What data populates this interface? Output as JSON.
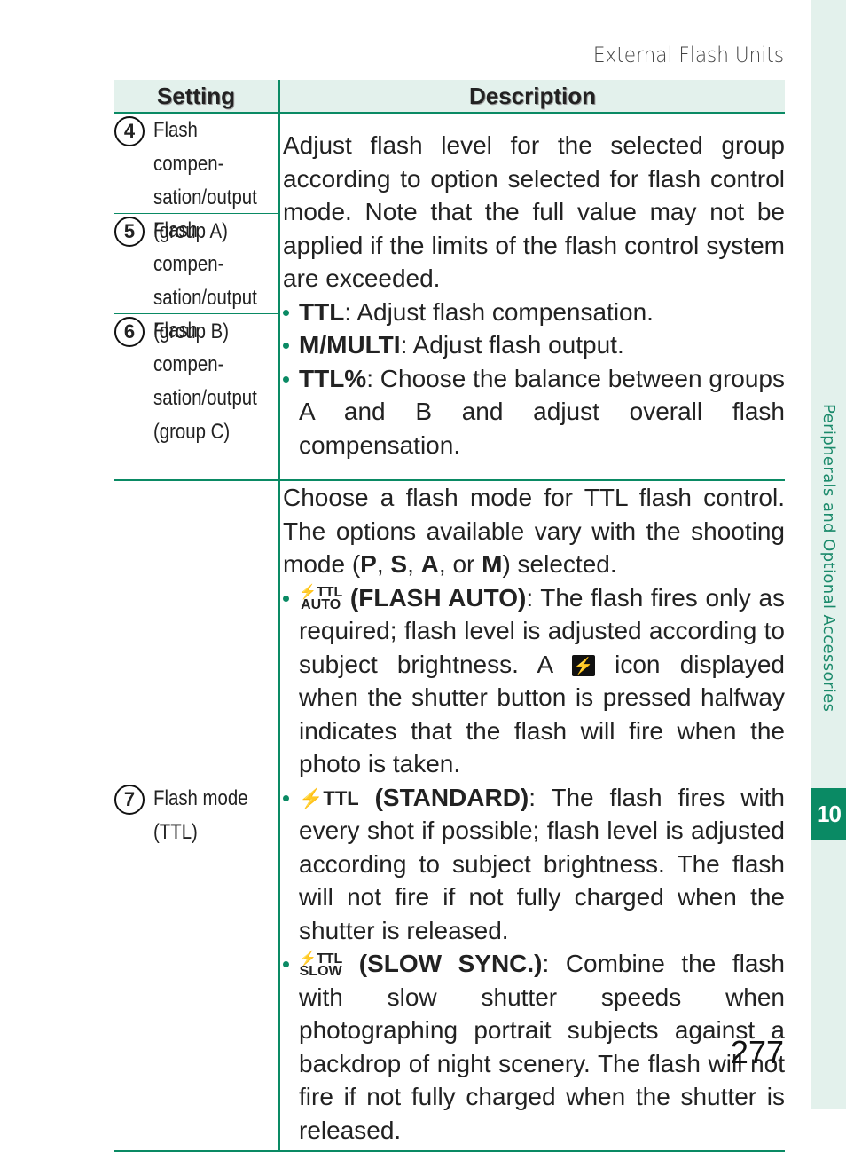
{
  "running_head": "External Flash Units",
  "page_number": "277",
  "side_tab": {
    "label": "Peripherals and Optional Accessories",
    "chapter": "10"
  },
  "table": {
    "headers": {
      "setting": "Setting",
      "description": "Description"
    },
    "group1": {
      "settings": [
        {
          "num": "4",
          "label": "Flash compen-\nsation/output\n(group A)"
        },
        {
          "num": "5",
          "label": "Flash compen-\nsation/output\n(group B)"
        },
        {
          "num": "6",
          "label": "Flash compen-\nsation/output\n(group C)"
        }
      ],
      "intro": "Adjust flash level for the selected group according to option selected for flash control mode. Note that the full value may not be applied if the limits of the flash control system are exceeded.",
      "bullets": [
        {
          "term": "TTL",
          "text": ": Adjust flash compensation."
        },
        {
          "term": "M/MULTI",
          "text": ": Adjust flash output."
        },
        {
          "term": "TTL%",
          "text": ": Choose the balance between groups A and B and adjust overall flash compensation."
        }
      ]
    },
    "group2": {
      "setting": {
        "num": "7",
        "label": "Flash mode\n(TTL)"
      },
      "intro_1": "Choose a flash mode for TTL flash control. The options available vary with the shooting mode (",
      "modes": [
        "P",
        "S",
        "A",
        "M"
      ],
      "intro_sep1": ", ",
      "intro_sep2": ", or ",
      "intro_end": ") selected.",
      "bullets": [
        {
          "icon": "ttl-auto-icon",
          "icon_text": "⚡TTL AUTO",
          "term": "(FLASH AUTO)",
          "text_1": ": The flash fires only as required; flash level is adjusted according to subject brightness. A ",
          "inline_icon": "flash-ready-icon",
          "text_2": " icon displayed when the shutter button is pressed halfway indicates that the flash will fire when the photo is taken."
        },
        {
          "icon": "ttl-standard-icon",
          "icon_text": "⚡TTL",
          "term": "(STANDARD)",
          "text_1": ": The flash fires with every shot if possible; flash level is adjusted according to subject brightness. The flash will not fire if not fully charged when the shutter is released."
        },
        {
          "icon": "ttl-slow-icon",
          "icon_text": "⚡TTL SLOW",
          "term": "(SLOW SYNC.)",
          "text_1": ": Combine the flash with slow shutter speeds when photographing portrait subjects against a backdrop of night scenery. The flash will not fire if not fully charged when the shutter is released."
        }
      ]
    }
  },
  "colors": {
    "accent": "#0a8a64",
    "tab_bg": "#e3f1ec"
  }
}
